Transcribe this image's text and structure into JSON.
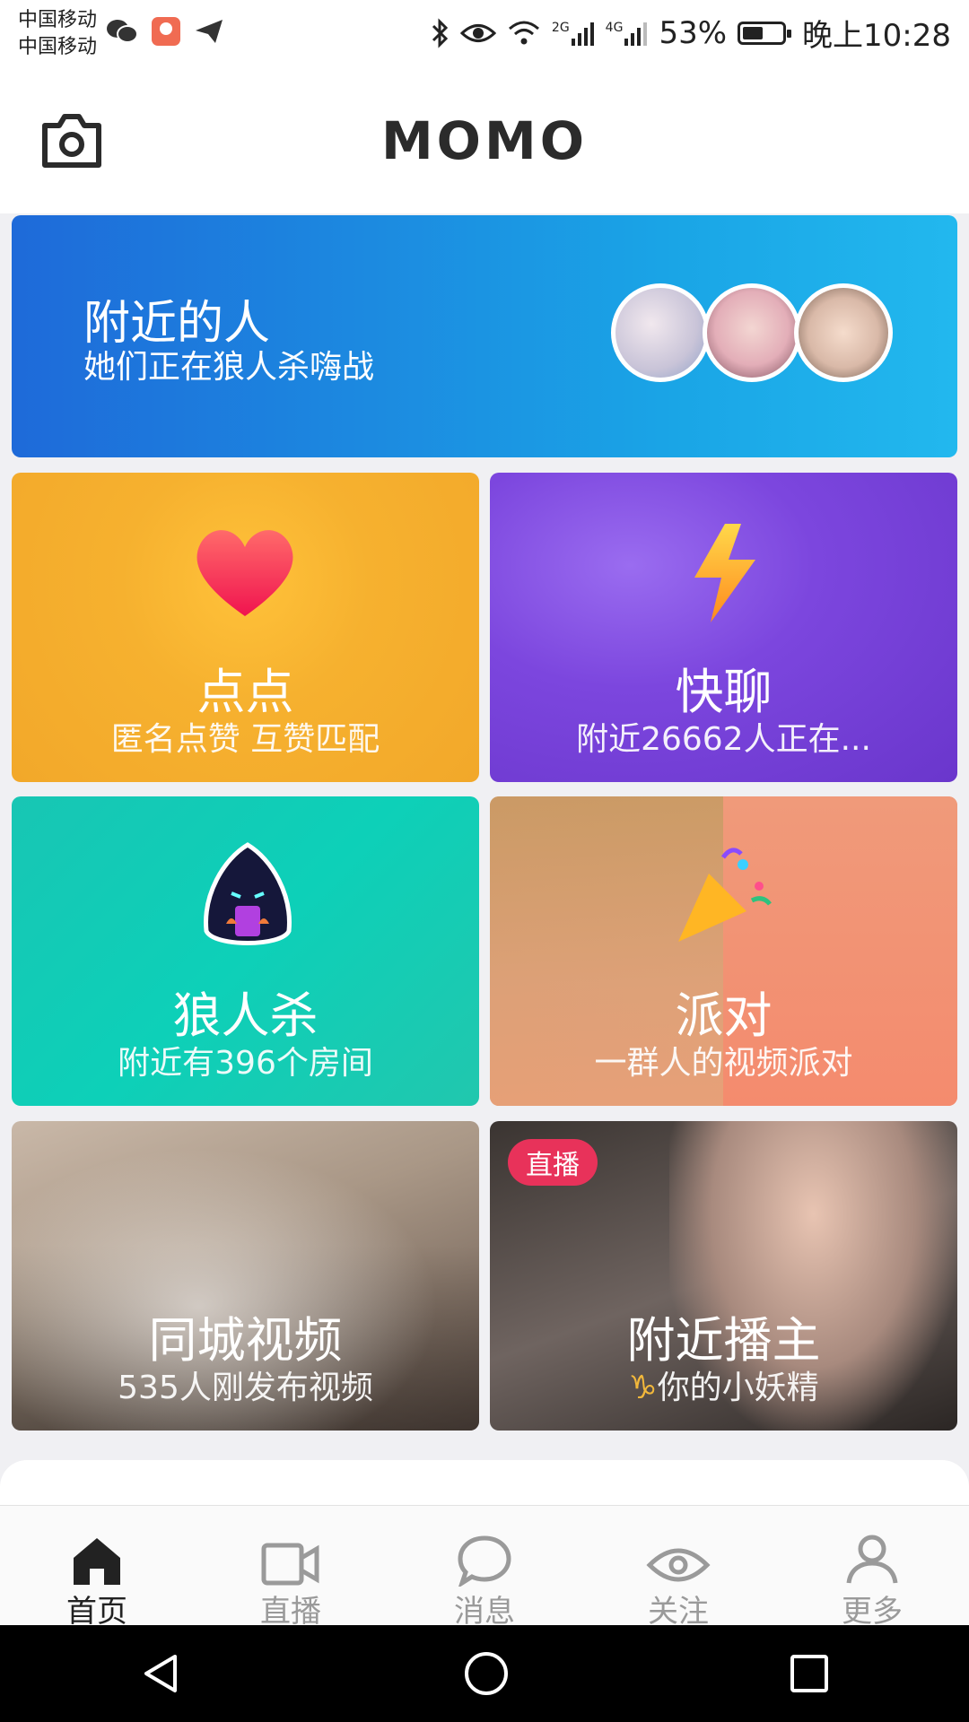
{
  "status_bar": {
    "carrier_1": "中国移动",
    "carrier_2": "中国移动",
    "signal_1_label": "2G",
    "signal_2_label": "4G",
    "battery": "53%",
    "time": "晚上10:28"
  },
  "header": {
    "logo": "MOMO",
    "camera_icon": "camera-icon"
  },
  "nearby_banner": {
    "title": "附近的人",
    "subtitle": "她们正在狼人杀嗨战"
  },
  "tiles": [
    {
      "title": "点点",
      "subtitle": "匿名点赞 互赞匹配",
      "icon": "heart-icon"
    },
    {
      "title": "快聊",
      "subtitle": "附近26662人正在...",
      "icon": "lightning-icon"
    },
    {
      "title": "狼人杀",
      "subtitle": "附近有396个房间",
      "icon": "werewolf-icon"
    },
    {
      "title": "派对",
      "subtitle": "一群人的视频派对",
      "icon": "party-popper-icon"
    },
    {
      "title": "同城视频",
      "subtitle": "535人刚发布视频"
    },
    {
      "title": "附近播主",
      "subtitle": "你的小妖精",
      "badge": "直播",
      "sub_icon": "capricorn-icon"
    }
  ],
  "tabbar": {
    "items": [
      {
        "label": "首页",
        "icon": "home-icon",
        "active": true
      },
      {
        "label": "直播",
        "icon": "video-camera-icon",
        "active": false
      },
      {
        "label": "消息",
        "icon": "chat-bubble-icon",
        "active": false
      },
      {
        "label": "关注",
        "icon": "eye-icon",
        "active": false
      },
      {
        "label": "更多",
        "icon": "person-icon",
        "active": false
      }
    ]
  },
  "colors": {
    "accent_live": "#e8325a",
    "nearby_gradient": [
      "#1e6ad9",
      "#22b8ee"
    ],
    "dd_bg": "#f2a82a",
    "kl_bg": "#7c46de",
    "lrs_bg": "#0dd0b8",
    "pd_bg": "#f2a468"
  }
}
